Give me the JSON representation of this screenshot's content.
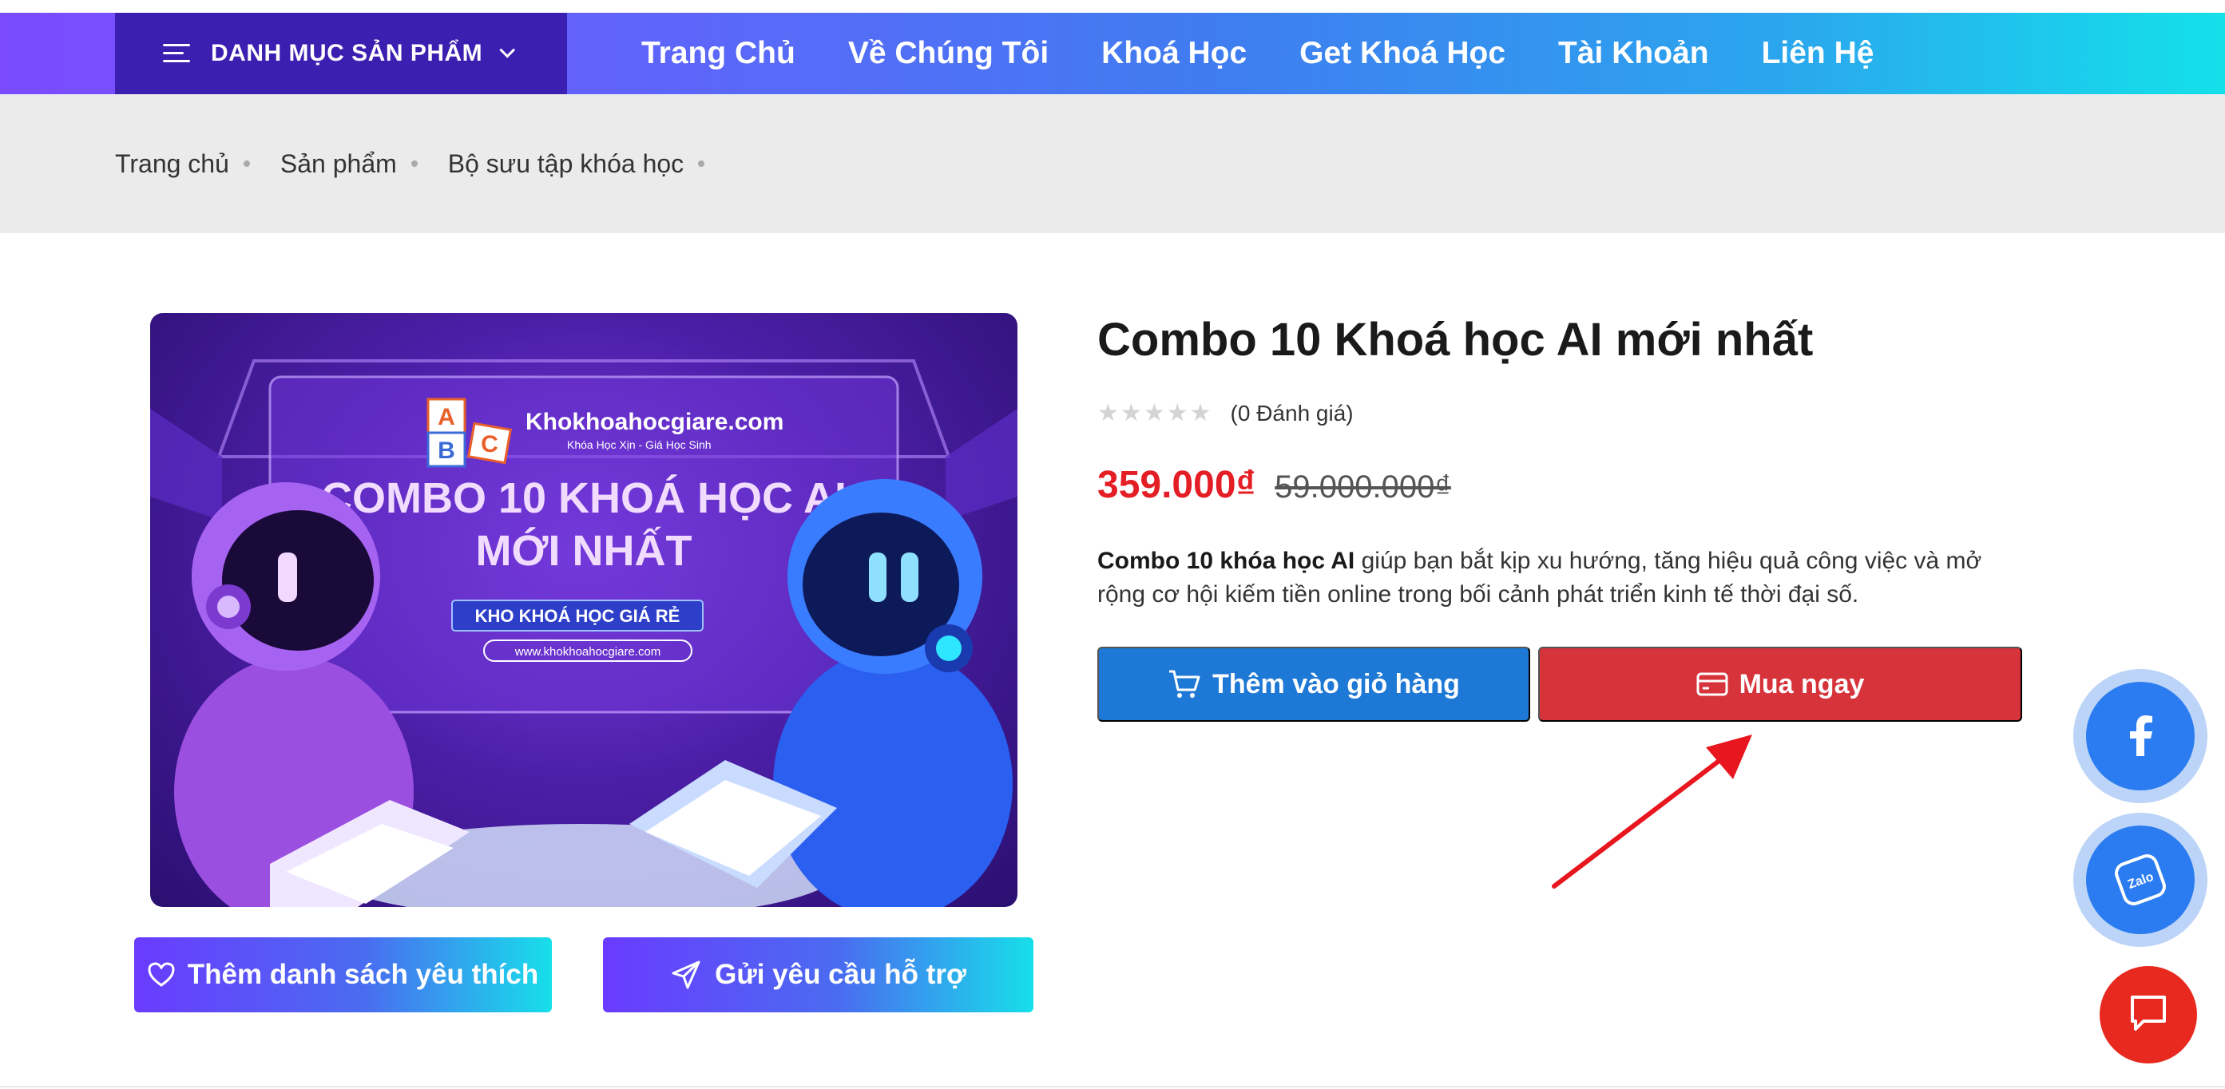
{
  "nav": {
    "category_menu": "DANH MỤC SẢN PHẨM",
    "links": [
      "Trang Chủ",
      "Về Chúng Tôi",
      "Khoá Học",
      "Get Khoá Học",
      "Tài Khoản",
      "Liên Hệ"
    ]
  },
  "breadcrumb": [
    "Trang chủ",
    "Sản phẩm",
    "Bộ sưu tập khóa học"
  ],
  "product_image": {
    "brand": "Khokhoahocgiare.com",
    "tagline": "Khóa Học Xịn - Giá Học Sinh",
    "headline_line1": "COMBO 10 KHOÁ HỌC AI",
    "headline_line2": "MỚI NHẤT",
    "badge": "KHO KHOÁ HỌC GIÁ RẺ",
    "url": "www.khokhoahocgiare.com",
    "blocks": [
      "A",
      "B",
      "C"
    ]
  },
  "product": {
    "title": "Combo 10 Khoá học AI mới nhất",
    "rating_value": 0,
    "rating_text": "(0 Đánh giá)",
    "price_new": "359.000₫",
    "price_old": "59.000.000₫",
    "desc_bold": "Combo 10 khóa học AI",
    "desc_rest": " giúp bạn bắt kịp xu hướng, tăng hiệu quả công việc và mở rộng cơ hội kiếm tiền online trong bối cảnh phát triển kinh tế thời đại số."
  },
  "buttons": {
    "add_to_cart": "Thêm vào giỏ hàng",
    "buy_now": "Mua ngay",
    "wishlist": "Thêm danh sách yêu thích",
    "support": "Gửi yêu cầu hỗ trợ"
  },
  "floating": {
    "zalo_label": "Zalo"
  },
  "colors": {
    "cart": "#1e78d6",
    "buy": "#d6333b",
    "price": "#e41e25",
    "nav_dark": "#3a1fb0"
  }
}
